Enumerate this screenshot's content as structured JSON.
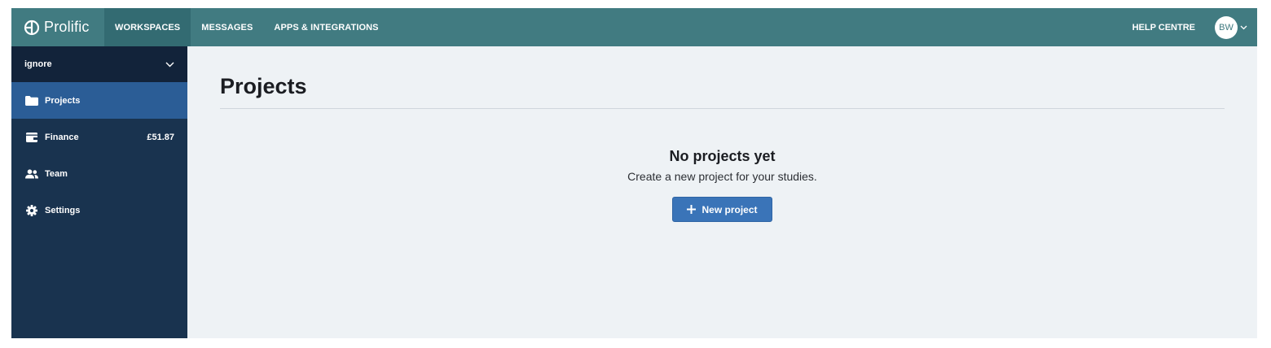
{
  "topbar": {
    "brand": "Prolific",
    "nav": [
      "WORKSPACES",
      "MESSAGES",
      "APPS & INTEGRATIONS"
    ],
    "help": "HELP CENTRE",
    "avatar_initials": "BW",
    "color": "#417b81"
  },
  "sidebar": {
    "workspace": "ignore",
    "items": [
      {
        "label": "Projects",
        "icon": "folder-icon",
        "active": true
      },
      {
        "label": "Finance",
        "icon": "wallet-icon",
        "amount": "£51.87"
      },
      {
        "label": "Team",
        "icon": "team-icon"
      },
      {
        "label": "Settings",
        "icon": "gear-icon"
      }
    ]
  },
  "main": {
    "title": "Projects",
    "empty_title": "No projects yet",
    "empty_subtitle": "Create a new project for your studies.",
    "new_project_label": "New project",
    "button_color": "#3a74b8"
  }
}
